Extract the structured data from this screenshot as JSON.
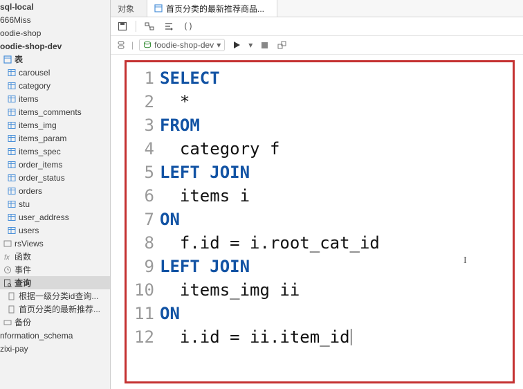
{
  "sidebar": {
    "connection": "sql-local",
    "databases": [
      "666Miss",
      "oodie-shop",
      "oodie-shop-dev"
    ],
    "tables_group_label": "表",
    "tables": [
      "carousel",
      "category",
      "items",
      "items_comments",
      "items_img",
      "items_param",
      "items_spec",
      "order_items",
      "order_status",
      "orders",
      "stu",
      "user_address",
      "users"
    ],
    "views_label": "rsViews",
    "functions_label": "函数",
    "events_label": "事件",
    "queries_label": "查询",
    "saved_queries": [
      "根据一级分类id查询...",
      "首页分类的最新推荐..."
    ],
    "backup_label": "备份",
    "other_dbs": [
      "nformation_schema",
      "zixi-pay"
    ]
  },
  "tabs": [
    {
      "label": "对象",
      "active": false
    },
    {
      "label": "首页分类的最新推荐商品...",
      "active": true
    }
  ],
  "runbar": {
    "db_selected": "foodie-shop-dev"
  },
  "sql": {
    "lines": [
      {
        "n": 1,
        "tokens": [
          {
            "t": "kw",
            "v": "SELECT"
          }
        ]
      },
      {
        "n": 2,
        "tokens": [
          {
            "t": "txt",
            "v": "  *"
          }
        ]
      },
      {
        "n": 3,
        "tokens": [
          {
            "t": "kw",
            "v": "FROM"
          }
        ]
      },
      {
        "n": 4,
        "tokens": [
          {
            "t": "txt",
            "v": "  category f"
          }
        ]
      },
      {
        "n": 5,
        "tokens": [
          {
            "t": "kw",
            "v": "LEFT JOIN"
          }
        ]
      },
      {
        "n": 6,
        "tokens": [
          {
            "t": "txt",
            "v": "  items i"
          }
        ]
      },
      {
        "n": 7,
        "tokens": [
          {
            "t": "kw",
            "v": "ON"
          }
        ]
      },
      {
        "n": 8,
        "tokens": [
          {
            "t": "txt",
            "v": "  f.id = i.root_cat_id"
          }
        ]
      },
      {
        "n": 9,
        "tokens": [
          {
            "t": "kw",
            "v": "LEFT JOIN"
          }
        ]
      },
      {
        "n": 10,
        "tokens": [
          {
            "t": "txt",
            "v": "  items_img ii"
          }
        ]
      },
      {
        "n": 11,
        "tokens": [
          {
            "t": "kw",
            "v": "ON"
          }
        ]
      },
      {
        "n": 12,
        "tokens": [
          {
            "t": "txt",
            "v": "  i.id = ii.item_id"
          }
        ],
        "cursor": true
      }
    ]
  }
}
